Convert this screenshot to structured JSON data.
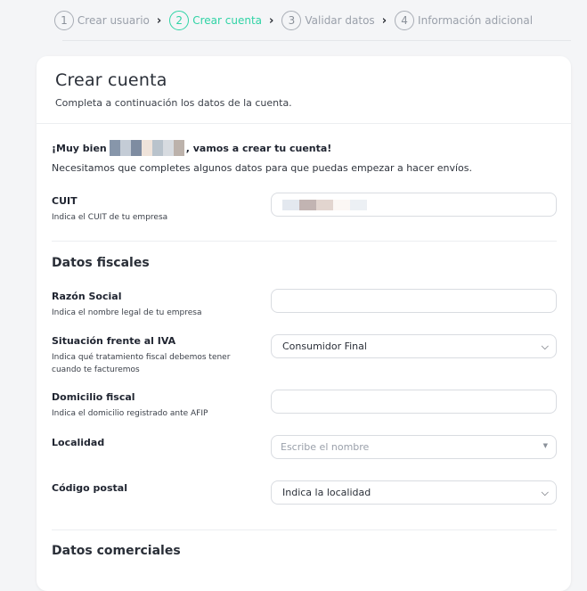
{
  "stepper": {
    "steps": [
      {
        "num": "1",
        "label": "Crear usuario"
      },
      {
        "num": "2",
        "label": "Crear cuenta"
      },
      {
        "num": "3",
        "label": "Validar datos"
      },
      {
        "num": "4",
        "label": "Información adicional"
      }
    ],
    "active_index": 1,
    "accent_color": "#2fd3a5"
  },
  "card": {
    "title": "Crear cuenta",
    "subtitle": "Completa a continuación los datos de la cuenta."
  },
  "greeting": {
    "prefix": "¡Muy bien",
    "suffix": ", vamos a crear tu cuenta!",
    "intro": "Necesitamos que completes algunos datos para que puedas empezar a hacer envíos."
  },
  "cuit": {
    "label": "CUIT",
    "hint": "Indica el CUIT de tu empresa"
  },
  "fiscal": {
    "section_title": "Datos fiscales",
    "razon_social": {
      "label": "Razón Social",
      "hint": "Indica el nombre legal de tu empresa",
      "value": ""
    },
    "iva": {
      "label": "Situación frente al IVA",
      "hint": "Indica qué tratamiento fiscal debemos tener cuando te facturemos",
      "value": "Consumidor Final"
    },
    "domicilio": {
      "label": "Domicilio fiscal",
      "hint": "Indica el domicilio registrado ante AFIP",
      "value": ""
    },
    "localidad": {
      "label": "Localidad",
      "placeholder": "Escribe el nombre"
    },
    "codigo_postal": {
      "label": "Código postal",
      "value": "Indica la localidad"
    }
  },
  "commercial": {
    "section_title": "Datos comerciales"
  }
}
